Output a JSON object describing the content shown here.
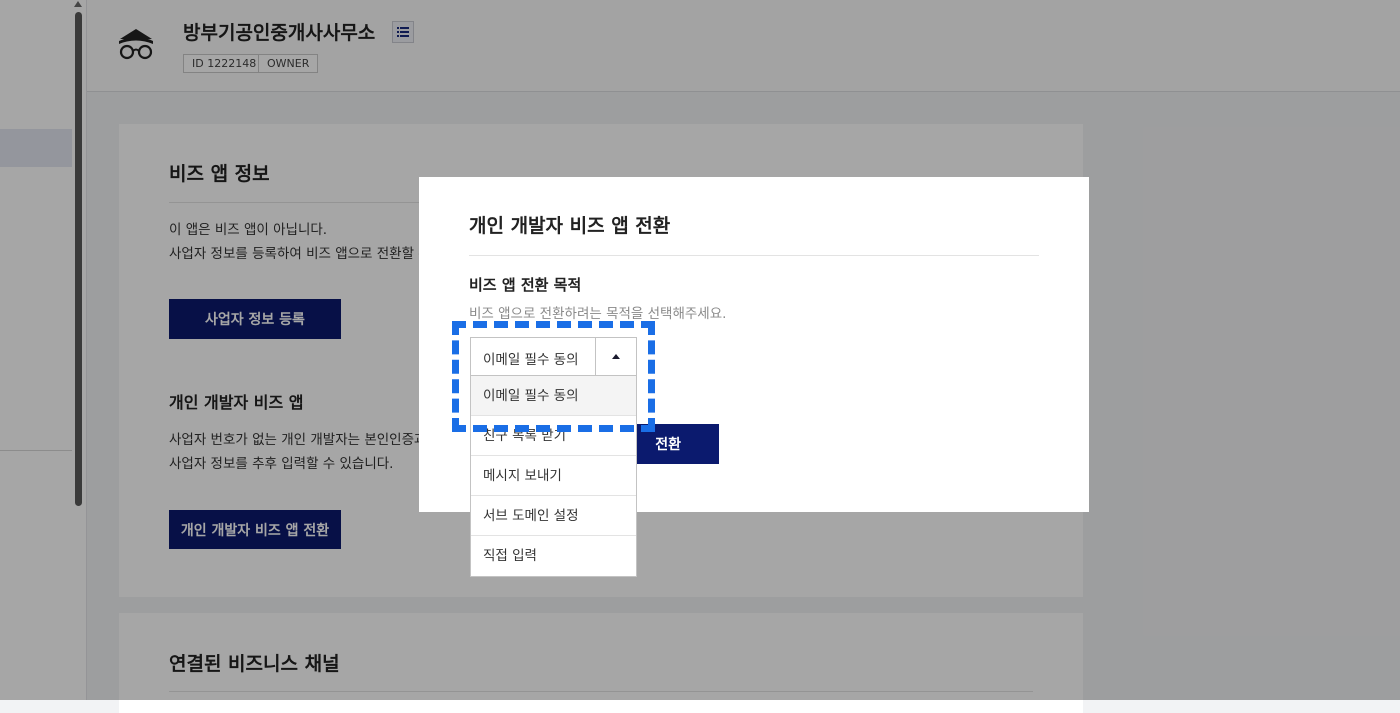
{
  "header": {
    "app_name": "방부기공인중개사사무소",
    "badges": [
      "ID 1222148",
      "OWNER"
    ]
  },
  "biz_info": {
    "title": "비즈 앱 정보",
    "desc_line1": "이 앱은 비즈 앱이 아닙니다.",
    "desc_line2": "사업자 정보를 등록하여 비즈 앱으로 전환할 수",
    "register_button": "사업자 정보 등록",
    "personal_title": "개인 개발자 비즈 앱",
    "personal_desc1": "사업자 번호가 없는 개인 개발자는 본인인증과",
    "personal_desc2": "사업자 정보를 추후 입력할 수 있습니다.",
    "personal_button": "개인 개발자 비즈 앱 전환"
  },
  "channels": {
    "title": "연결된 비즈니스 채널"
  },
  "modal": {
    "title": "개인 개발자 비즈 앱 전환",
    "field_label": "비즈 앱 전환 목적",
    "field_help": "비즈 앱으로 전환하려는 목적을 선택해주세요.",
    "selected_value": "이메일 필수 동의",
    "options": [
      "이메일 필수 동의",
      "친구 목록 받기",
      "메시지 보내기",
      "서브 도메인 설정",
      "직접 입력"
    ],
    "submit_button": "전환"
  },
  "colors": {
    "navy": "#0b1a6e",
    "highlight": "#1a6ee6"
  }
}
